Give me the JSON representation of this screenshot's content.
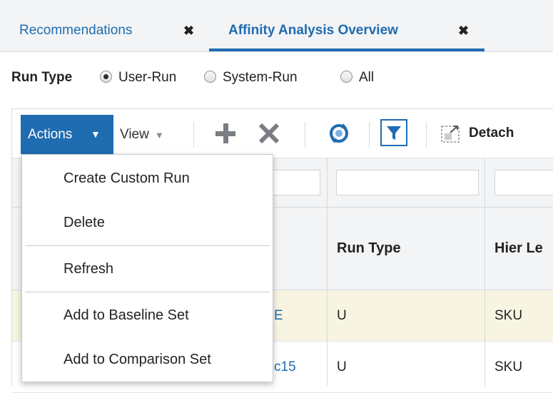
{
  "tabs": [
    {
      "label": "Recommendations",
      "close": "✖"
    },
    {
      "label": "Affinity Analysis Overview",
      "close": "✖"
    }
  ],
  "run_type": {
    "title": "Run Type",
    "options": [
      {
        "label": "User-Run",
        "checked": true
      },
      {
        "label": "System-Run",
        "checked": false
      },
      {
        "label": "All",
        "checked": false
      }
    ]
  },
  "toolbar": {
    "actions_label": "Actions",
    "view_label": "View",
    "detach_label": "Detach",
    "icons": [
      "plus-icon",
      "delete-x-icon",
      "refresh-sync-icon",
      "filter-icon",
      "detach-icon"
    ]
  },
  "table": {
    "headers": [
      "Run Type",
      "Hier Le"
    ],
    "rows": [
      {
        "name_partial": "E",
        "run_type": "U",
        "hier_level": "SKU"
      },
      {
        "name_partial": "c15",
        "run_type": "U",
        "hier_level": "SKU"
      }
    ]
  },
  "menu": {
    "items": [
      "Create Custom Run",
      "Delete",
      "Refresh",
      "Add to Baseline Set",
      "Add to Comparison Set"
    ]
  },
  "colors": {
    "accent": "#1f6cb0",
    "highlight_row": "#f7f5e2",
    "header_bg": "#f3f4f5"
  }
}
